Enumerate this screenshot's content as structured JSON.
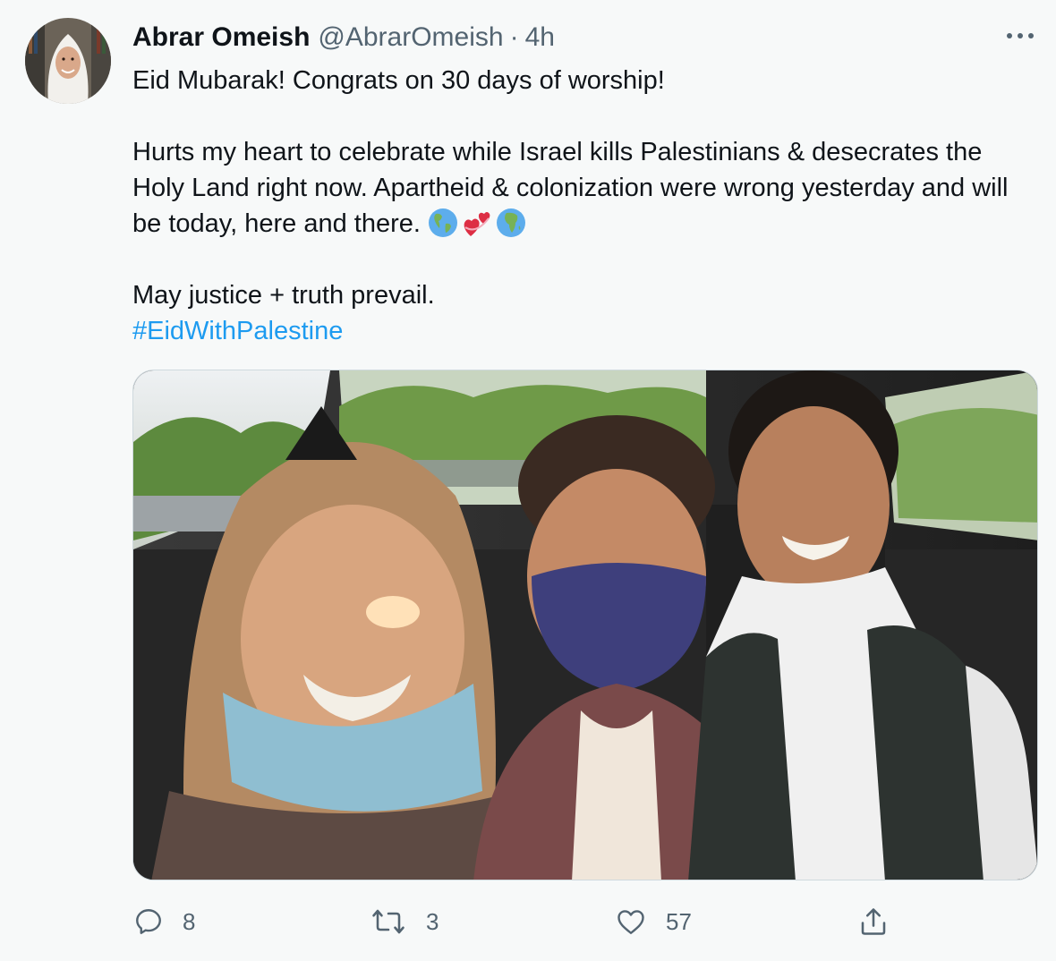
{
  "author": {
    "display_name": "Abrar Omeish",
    "handle": "@AbrarOmeish",
    "separator": "·",
    "time": "4h"
  },
  "tweet": {
    "line1": "Eid Mubarak! Congrats on 30 days of worship!",
    "line2": "Hurts my heart to celebrate while Israel kills Palestinians & desecrates the Holy Land right now. Apartheid & colonization were wrong yesterday and will be today, here and there.",
    "emojis": [
      "globe-americas-emoji",
      "revolving-hearts-emoji",
      "globe-africa-emoji"
    ],
    "line3": "May justice + truth prevail.",
    "hashtag": "#EidWithPalestine"
  },
  "actions": {
    "reply_count": "8",
    "retweet_count": "3",
    "like_count": "57"
  },
  "icons": {
    "more": "more-icon",
    "reply": "reply-icon",
    "retweet": "retweet-icon",
    "like": "heart-icon",
    "share": "share-icon"
  },
  "colors": {
    "text": "#0f1419",
    "muted": "#536471",
    "link": "#1d9bf0"
  }
}
